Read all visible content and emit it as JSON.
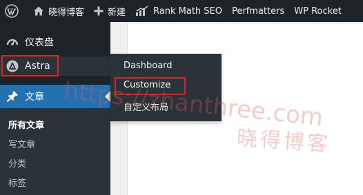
{
  "admin_bar": {
    "wp_logo_icon": "wordpress-logo-icon",
    "site_name": "晓得博客",
    "site_icon": "home-icon",
    "new_label": "新建",
    "new_icon": "plus-icon",
    "rank_math_label": "Rank Math SEO",
    "rank_math_icon": "rank-math-icon",
    "perfmatters_label": "Perfmatters",
    "wp_rocket_label": "WP Rocket"
  },
  "sidebar": {
    "dashboard": {
      "label": "仪表盘",
      "icon": "dashboard-gauge-icon"
    },
    "astra": {
      "label": "Astra",
      "icon": "astra-logo-icon"
    },
    "posts": {
      "label": "文章",
      "icon": "pushpin-icon",
      "submenu": [
        "所有文章",
        "写文章",
        "分类",
        "标签"
      ]
    }
  },
  "flyout": {
    "items": [
      "Dashboard",
      "Customize",
      "自定义布局"
    ]
  },
  "annotations": {
    "highlight_color": "#e1231f"
  },
  "watermark": {
    "url_text": "https://zhanthree.com",
    "name_text": "晓得博客"
  },
  "colors": {
    "admin_dark": "#1d2327",
    "menu_active": "#2271b1",
    "submenu_bg": "#2c3338",
    "content_bg": "#ffffff"
  }
}
